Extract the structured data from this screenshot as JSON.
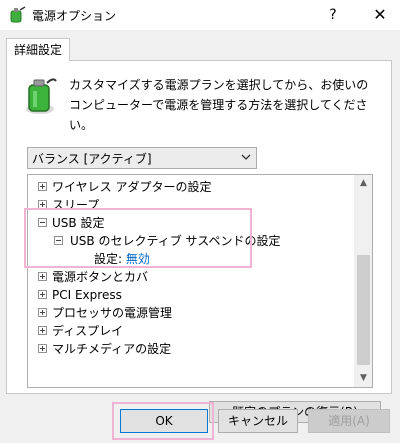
{
  "window": {
    "title": "電源オプション",
    "help": "?",
    "close": "✕"
  },
  "tab": {
    "label": "詳細設定"
  },
  "description": "カスタマイズする電源プランを選択してから、お使いのコンピューターで電源を管理する方法を選択してください。",
  "plan_select": {
    "value": "バランス [アクティブ]"
  },
  "tree": {
    "items": [
      {
        "label": "ワイヤレス アダプターの設定",
        "expander": "+"
      },
      {
        "label": "スリープ",
        "expander": "+"
      },
      {
        "label": "USB 設定",
        "expander": "−"
      },
      {
        "label": "USB のセレクティブ サスペンドの設定",
        "expander": "−"
      },
      {
        "label": "設定:",
        "value": "無効"
      },
      {
        "label": "電源ボタンとカバ",
        "expander": "+"
      },
      {
        "label": "PCI Express",
        "expander": "+"
      },
      {
        "label": "プロセッサの電源管理",
        "expander": "+"
      },
      {
        "label": "ディスプレイ",
        "expander": "+"
      },
      {
        "label": "マルチメディアの設定",
        "expander": "+"
      }
    ]
  },
  "buttons": {
    "restore": "既定のプランの復元(R)",
    "ok": "OK",
    "cancel": "キャンセル",
    "apply": "適用(A)"
  },
  "colors": {
    "highlight": "#f0b4d2",
    "link_value": "#0066cc"
  }
}
